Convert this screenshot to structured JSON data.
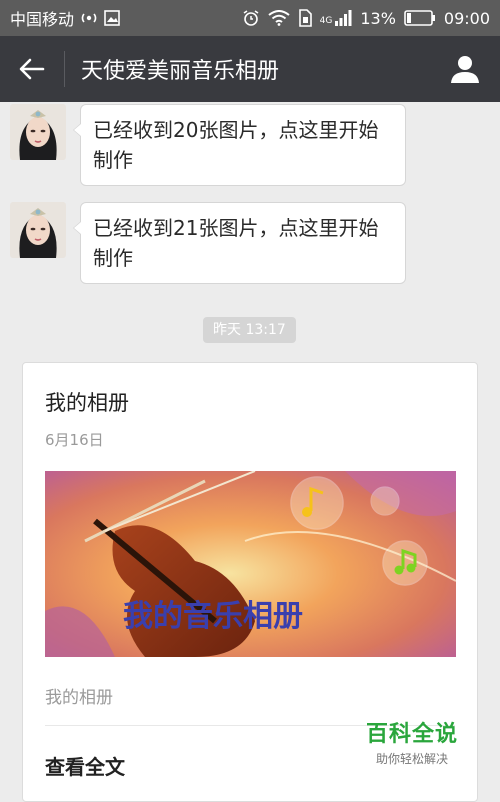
{
  "status_bar": {
    "carrier": "中国移动",
    "network": "4G",
    "battery": "13%",
    "time": "09:00"
  },
  "header": {
    "title": "天使爱美丽音乐相册"
  },
  "messages": [
    {
      "text": "已经收到20张图片，点这里开始制作"
    },
    {
      "text": "已经收到21张图片，点这里开始制作"
    }
  ],
  "timestamp": "昨天 13:17",
  "card": {
    "title": "我的相册",
    "date": "6月16日",
    "banner_text": "我的音乐相册",
    "description": "我的相册",
    "read_more": "查看全文"
  },
  "watermark": {
    "main": "百科全说",
    "sub": "助你轻松解决"
  }
}
